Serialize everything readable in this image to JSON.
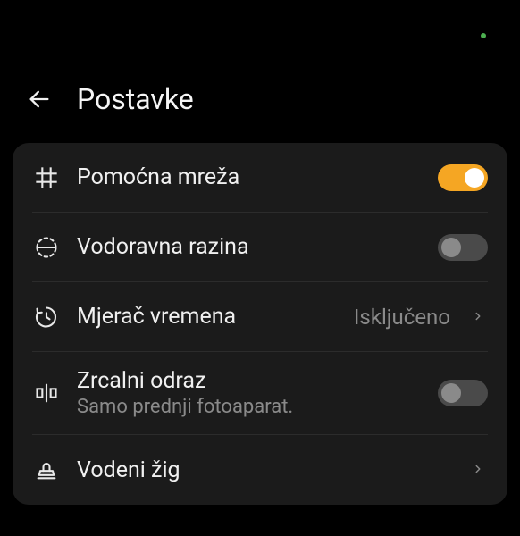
{
  "header": {
    "title": "Postavke"
  },
  "settings": {
    "grid": {
      "label": "Pomoćna mreža",
      "enabled": true
    },
    "level": {
      "label": "Vodoravna razina",
      "enabled": false
    },
    "timer": {
      "label": "Mjerač vremena",
      "value": "Isključeno"
    },
    "mirror": {
      "label": "Zrcalni odraz",
      "sublabel": "Samo prednji fotoaparat.",
      "enabled": false
    },
    "watermark": {
      "label": "Vodeni žig"
    }
  }
}
